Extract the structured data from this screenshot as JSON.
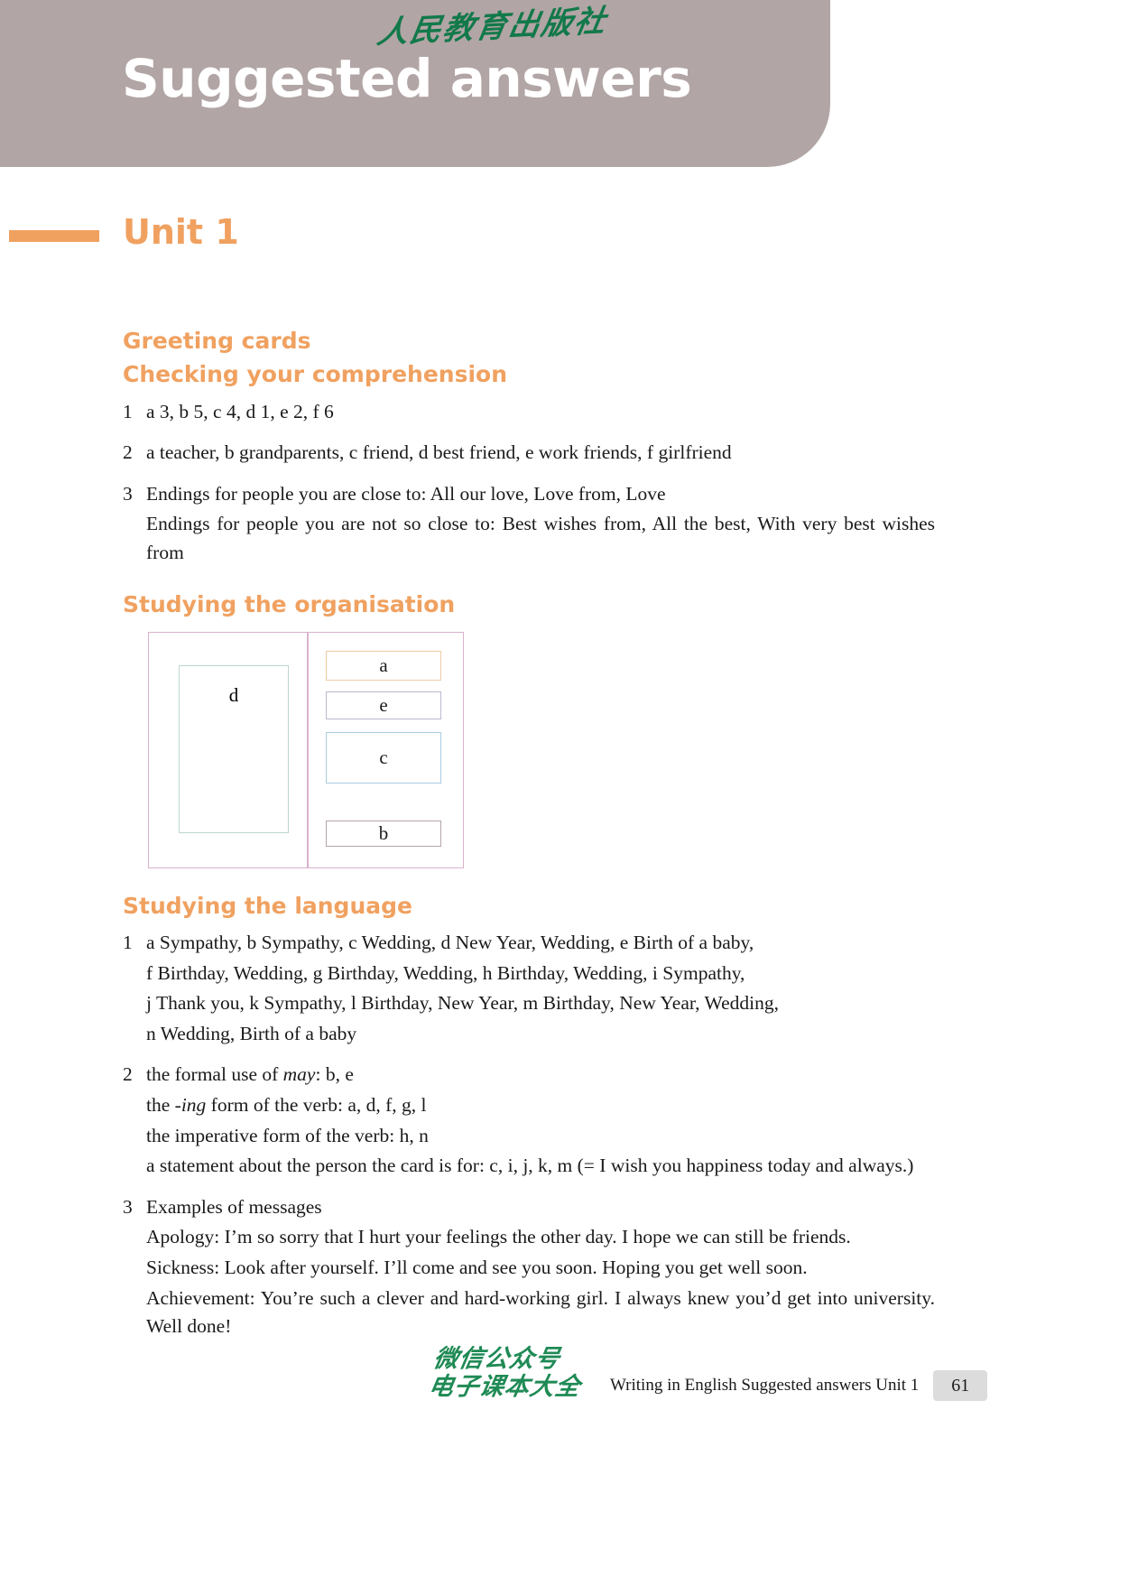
{
  "header": {
    "title": "Suggested answers",
    "publisher_mark": "人民教育出版社"
  },
  "unit": {
    "title": "Unit 1"
  },
  "sections": {
    "greeting_cards": "Greeting cards",
    "checking_comprehension": "Checking your comprehension",
    "studying_organisation": "Studying the organisation",
    "studying_language": "Studying the language"
  },
  "comprehension": {
    "item1": {
      "marker": "1",
      "line1": "a 3, b 5, c 4, d 1, e 2, f 6"
    },
    "item2": {
      "marker": "2",
      "line1": "a teacher, b grandparents, c friend, d best friend, e work friends, f girlfriend"
    },
    "item3": {
      "marker": "3",
      "line1": "Endings for people you are close to: All our love, Love from, Love",
      "line2": "Endings for people you are not so close to: Best wishes from, All the best, With very best wishes from"
    }
  },
  "diagram": {
    "left_panel_label": "d",
    "slot_a": "a",
    "slot_e": "e",
    "slot_c": "c",
    "slot_b": "b"
  },
  "language": {
    "item1": {
      "marker": "1",
      "line1": "a Sympathy, b Sympathy, c Wedding, d New Year, Wedding, e Birth of a baby,",
      "line2": "f Birthday, Wedding, g Birthday, Wedding, h Birthday, Wedding, i Sympathy,",
      "line3": "j Thank you, k Sympathy, l Birthday, New Year, m Birthday, New Year, Wedding,",
      "line4": "n Wedding, Birth of a baby"
    },
    "item2": {
      "marker": "2",
      "line1_pre": "the formal use of ",
      "line1_italic": "may",
      "line1_post": ": b, e",
      "line2_pre": "the ",
      "line2_italic": "-ing",
      "line2_post": " form of the verb: a, d, f, g, l",
      "line3": "the imperative form of the verb: h, n",
      "line4": "a statement about the person the card is for: c, i, j, k, m (= I wish you happiness today and always.)"
    },
    "item3": {
      "marker": "3",
      "line1": "Examples of messages",
      "line2": "Apology: I’m so sorry that I hurt your feelings the other day. I hope we can still be friends.",
      "line3": "Sickness: Look after yourself. I’ll come and see you soon. Hoping you get well soon.",
      "line4": "Achievement: You’re such a clever and hard-working girl. I always knew you’d get into university. Well done!"
    }
  },
  "footer": {
    "watermark_line1": "微信公众号",
    "watermark_line2": "电子课本大全",
    "caption": "Writing in English Suggested answers Unit 1",
    "page_number": "61"
  },
  "colors": {
    "banner": "#b2a5a5",
    "accent_orange": "#f0a160",
    "watermark_green": "#12794a"
  }
}
